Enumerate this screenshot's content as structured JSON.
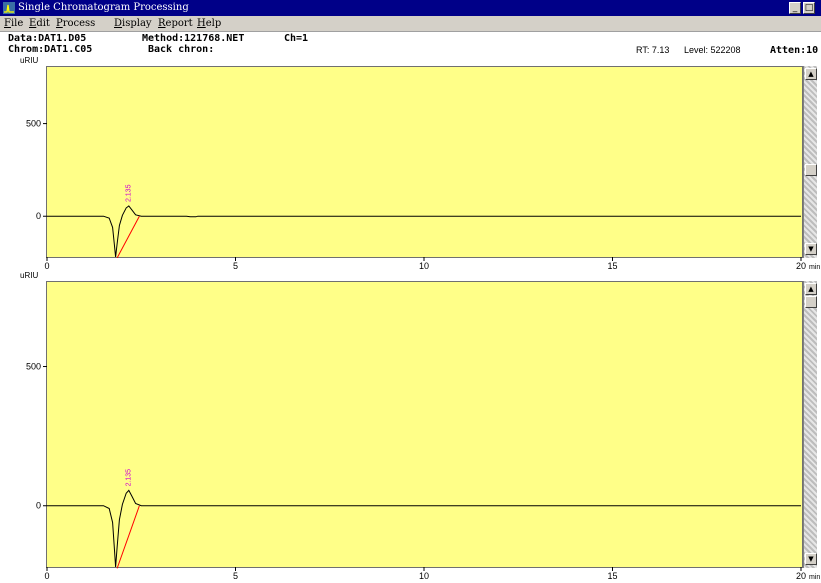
{
  "window": {
    "title": "Single Chromatogram Processing",
    "minimize_glyph": "_",
    "maximize_glyph": "□"
  },
  "menu": {
    "items": [
      {
        "accel": "F",
        "rest": "ile"
      },
      {
        "accel": "E",
        "rest": "dit"
      },
      {
        "accel": "P",
        "rest": "rocess"
      },
      {
        "accel": "D",
        "rest": "isplay"
      },
      {
        "accel": "R",
        "rest": "eport"
      },
      {
        "accel": "H",
        "rest": "elp"
      }
    ]
  },
  "info": {
    "data": "Data:DAT1.D05",
    "method": "Method:121768.NET",
    "ch": "Ch=1",
    "chrom": "Chrom:DAT1.C05",
    "back": "Back chron:",
    "rt": "RT: 7.13",
    "level": "Level: 522208",
    "atten": "Atten:10"
  },
  "icons": {
    "app": "chromatogram-app-icon",
    "scroll_up": "arrow-up-icon",
    "scroll_down": "arrow-down-icon"
  },
  "colors": {
    "plot_bg": "#ffff88",
    "trace": "#000000",
    "baseline_fit": "#ff0000",
    "peak_label": "#d000d0",
    "titlebar": "#000088"
  },
  "chart_data": [
    {
      "type": "line",
      "ylabel": "uRIU",
      "xlabel": "min",
      "xlim": [
        0,
        20
      ],
      "ylim": [
        -220,
        800
      ],
      "x_ticks": [
        0,
        5,
        10,
        15,
        20
      ],
      "y_ticks": [
        0,
        500
      ],
      "tick_labels_x": [
        "0",
        "5",
        "10",
        "15",
        "20"
      ],
      "tick_labels_y": [
        "0",
        "500"
      ],
      "peak_label": "2.135",
      "peak_label_x": 2.135,
      "series": [
        {
          "points": [
            [
              0,
              0
            ],
            [
              1.5,
              0
            ],
            [
              1.65,
              -10
            ],
            [
              1.74,
              -60
            ],
            [
              1.79,
              -160
            ],
            [
              1.82,
              -220
            ],
            [
              1.86,
              -150
            ],
            [
              1.92,
              -50
            ],
            [
              2.0,
              5
            ],
            [
              2.1,
              45
            ],
            [
              2.17,
              55
            ],
            [
              2.25,
              35
            ],
            [
              2.35,
              8
            ],
            [
              2.5,
              0
            ],
            [
              3.7,
              0
            ],
            [
              3.8,
              -3
            ],
            [
              3.95,
              -3
            ],
            [
              4.0,
              0
            ],
            [
              20,
              0
            ]
          ]
        }
      ],
      "baseline_fit": [
        [
          1.86,
          -225
        ],
        [
          2.45,
          0
        ]
      ]
    },
    {
      "type": "line",
      "ylabel": "uRIU",
      "xlabel": "min",
      "xlim": [
        0,
        20
      ],
      "ylim": [
        -220,
        800
      ],
      "x_ticks": [
        0,
        5,
        10,
        15,
        20
      ],
      "y_ticks": [
        0,
        500
      ],
      "tick_labels_x": [
        "0",
        "5",
        "10",
        "15",
        "20"
      ],
      "tick_labels_y": [
        "0",
        "500"
      ],
      "peak_label": "2.135",
      "peak_label_x": 2.135,
      "series": [
        {
          "points": [
            [
              0,
              0
            ],
            [
              1.5,
              0
            ],
            [
              1.65,
              -10
            ],
            [
              1.74,
              -60
            ],
            [
              1.79,
              -160
            ],
            [
              1.82,
              -220
            ],
            [
              1.86,
              -150
            ],
            [
              1.92,
              -50
            ],
            [
              2.0,
              5
            ],
            [
              2.1,
              45
            ],
            [
              2.17,
              55
            ],
            [
              2.25,
              35
            ],
            [
              2.35,
              8
            ],
            [
              2.5,
              0
            ],
            [
              20,
              0
            ]
          ]
        }
      ],
      "baseline_fit": [
        [
          1.86,
          -225
        ],
        [
          2.45,
          0
        ]
      ]
    }
  ]
}
